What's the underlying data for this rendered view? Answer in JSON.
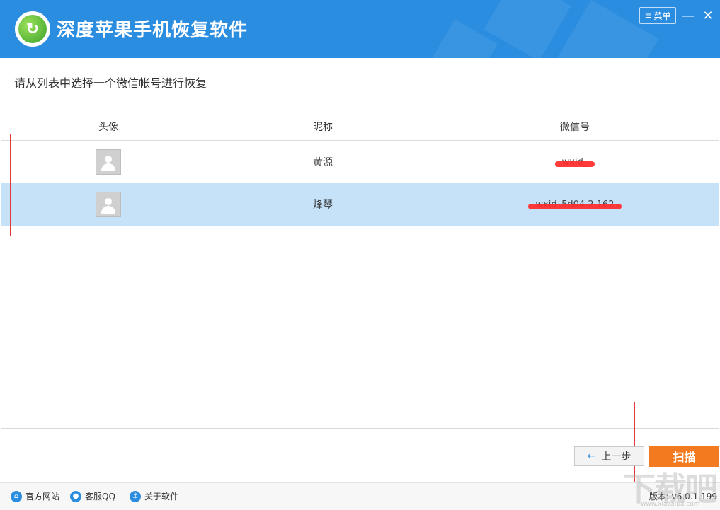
{
  "app": {
    "title": "深度苹果手机恢复软件",
    "logo_icon": "app-logo-icon"
  },
  "titlebar": {
    "menu_label": "菜单",
    "menu_icon": "≡",
    "minimize_icon": "—",
    "close_icon": "✕"
  },
  "instruction": "请从列表中选择一个微信帐号进行恢复",
  "table": {
    "headers": {
      "avatar": "头像",
      "nickname": "昵称",
      "wechat_id": "微信号"
    },
    "rows": [
      {
        "nickname": "黄源",
        "wechat_id": "wxid_",
        "selected": false
      },
      {
        "nickname": "烽琴",
        "wechat_id": "wxid_5d04 2 162",
        "selected": true
      }
    ]
  },
  "buttons": {
    "prev_label": "上一步",
    "prev_icon": "←",
    "scan_label": "扫描"
  },
  "footer": {
    "official_site": "官方网站",
    "support_qq": "客服QQ",
    "about": "关于软件",
    "version": "版本: v6.0.1.199"
  },
  "watermark": {
    "main": "下载吧",
    "sub": "www.xiazaiba.com"
  },
  "colors": {
    "titlebar": "#2b8de0",
    "selected_row": "#c5e2f8",
    "scan_button": "#f47a1f",
    "annotation": "#e0393b",
    "redaction": "#ff2a2a"
  }
}
